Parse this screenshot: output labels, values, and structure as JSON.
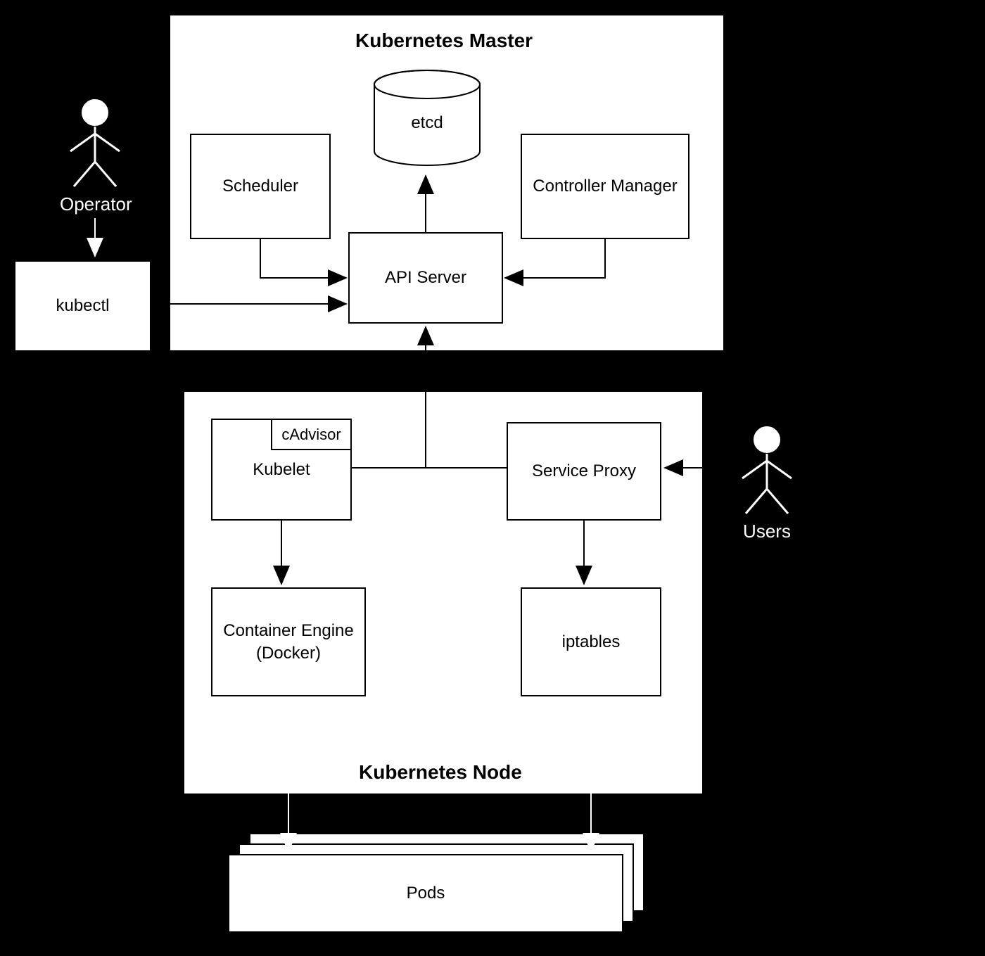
{
  "external": {
    "operator": "Operator",
    "kubectl": "kubectl",
    "users": "Users"
  },
  "master": {
    "title": "Kubernetes Master",
    "scheduler": "Scheduler",
    "etcd": "etcd",
    "controller_manager": "Controller Manager",
    "api_server": "API Server"
  },
  "node": {
    "title": "Kubernetes Node",
    "kubelet": "Kubelet",
    "cadvisor": "cAdvisor",
    "service_proxy": "Service Proxy",
    "container_engine": "Container Engine\n(Docker)",
    "iptables": "iptables",
    "pods": "Pods"
  }
}
